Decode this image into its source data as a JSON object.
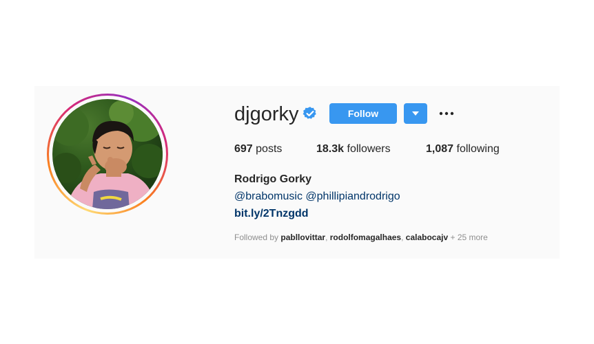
{
  "profile": {
    "username": "djgorky",
    "full_name": "Rodrigo Gorky",
    "mentions": [
      "@brabomusic",
      "@phillipiandrodrigo"
    ],
    "link": "bit.ly/2Tnzgdd"
  },
  "actions": {
    "follow_label": "Follow",
    "dropdown_icon": "caret-down-icon",
    "more_icon": "ellipsis-icon",
    "more_label": "···"
  },
  "stats": {
    "posts_count": "697",
    "posts_label": " posts",
    "followers_count": "18.3k",
    "followers_label": " followers",
    "following_count": "1,087",
    "following_label": " following"
  },
  "followed_by": {
    "prefix": "Followed by ",
    "users": [
      "pabllovittar",
      "rodolfomagalhaes",
      "calabocajv"
    ],
    "suffix": " + 25 more"
  },
  "colors": {
    "accent": "#3897f0",
    "link": "#003569",
    "verified": "#3897f0",
    "muted": "#8e8e8e"
  }
}
